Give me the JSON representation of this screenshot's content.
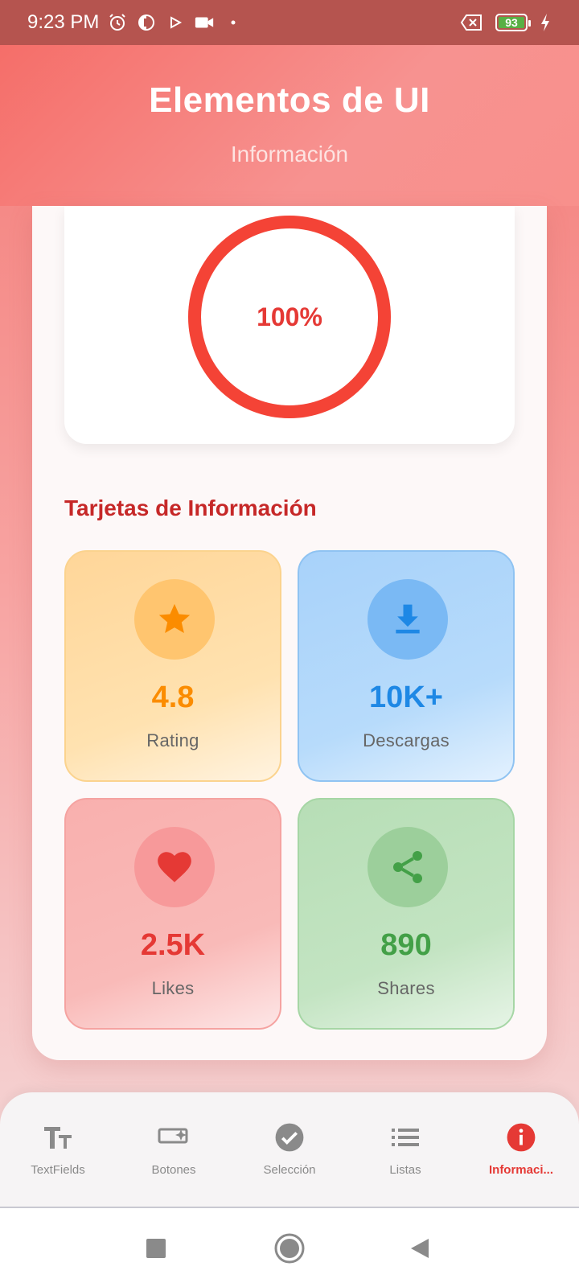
{
  "status_bar": {
    "time": "9:23 PM",
    "battery_level": "93",
    "battery_fraction": 0.93,
    "icons": [
      "alarm-icon",
      "app-notification-icon",
      "play-icon",
      "video-camera-icon",
      "dot-icon",
      "sim-error-icon",
      "battery-icon",
      "charging-icon"
    ]
  },
  "header": {
    "title": "Elementos de UI",
    "subtitle": "Información"
  },
  "progress": {
    "value_label": "100%",
    "fraction": 1.0,
    "color": "#f44336"
  },
  "info_section": {
    "title": "Tarjetas de Información",
    "cards": [
      {
        "value": "4.8",
        "label": "Rating",
        "icon": "star-icon",
        "color": "#fb8c00"
      },
      {
        "value": "10K+",
        "label": "Descargas",
        "icon": "download-icon",
        "color": "#1e88e5"
      },
      {
        "value": "2.5K",
        "label": "Likes",
        "icon": "heart-icon",
        "color": "#e53935"
      },
      {
        "value": "890",
        "label": "Shares",
        "icon": "share-icon",
        "color": "#43a047"
      }
    ]
  },
  "bottom_nav": {
    "items": [
      {
        "label": "TextFields",
        "icon": "text-fields-icon"
      },
      {
        "label": "Botones",
        "icon": "button-icon"
      },
      {
        "label": "Selección",
        "icon": "check-circle-icon"
      },
      {
        "label": "Listas",
        "icon": "list-icon"
      },
      {
        "label": "Informaci...",
        "icon": "info-icon",
        "active": true
      }
    ],
    "active_color": "#e53935"
  },
  "system_nav": {
    "buttons": [
      "recents-button",
      "home-button",
      "back-button"
    ]
  }
}
